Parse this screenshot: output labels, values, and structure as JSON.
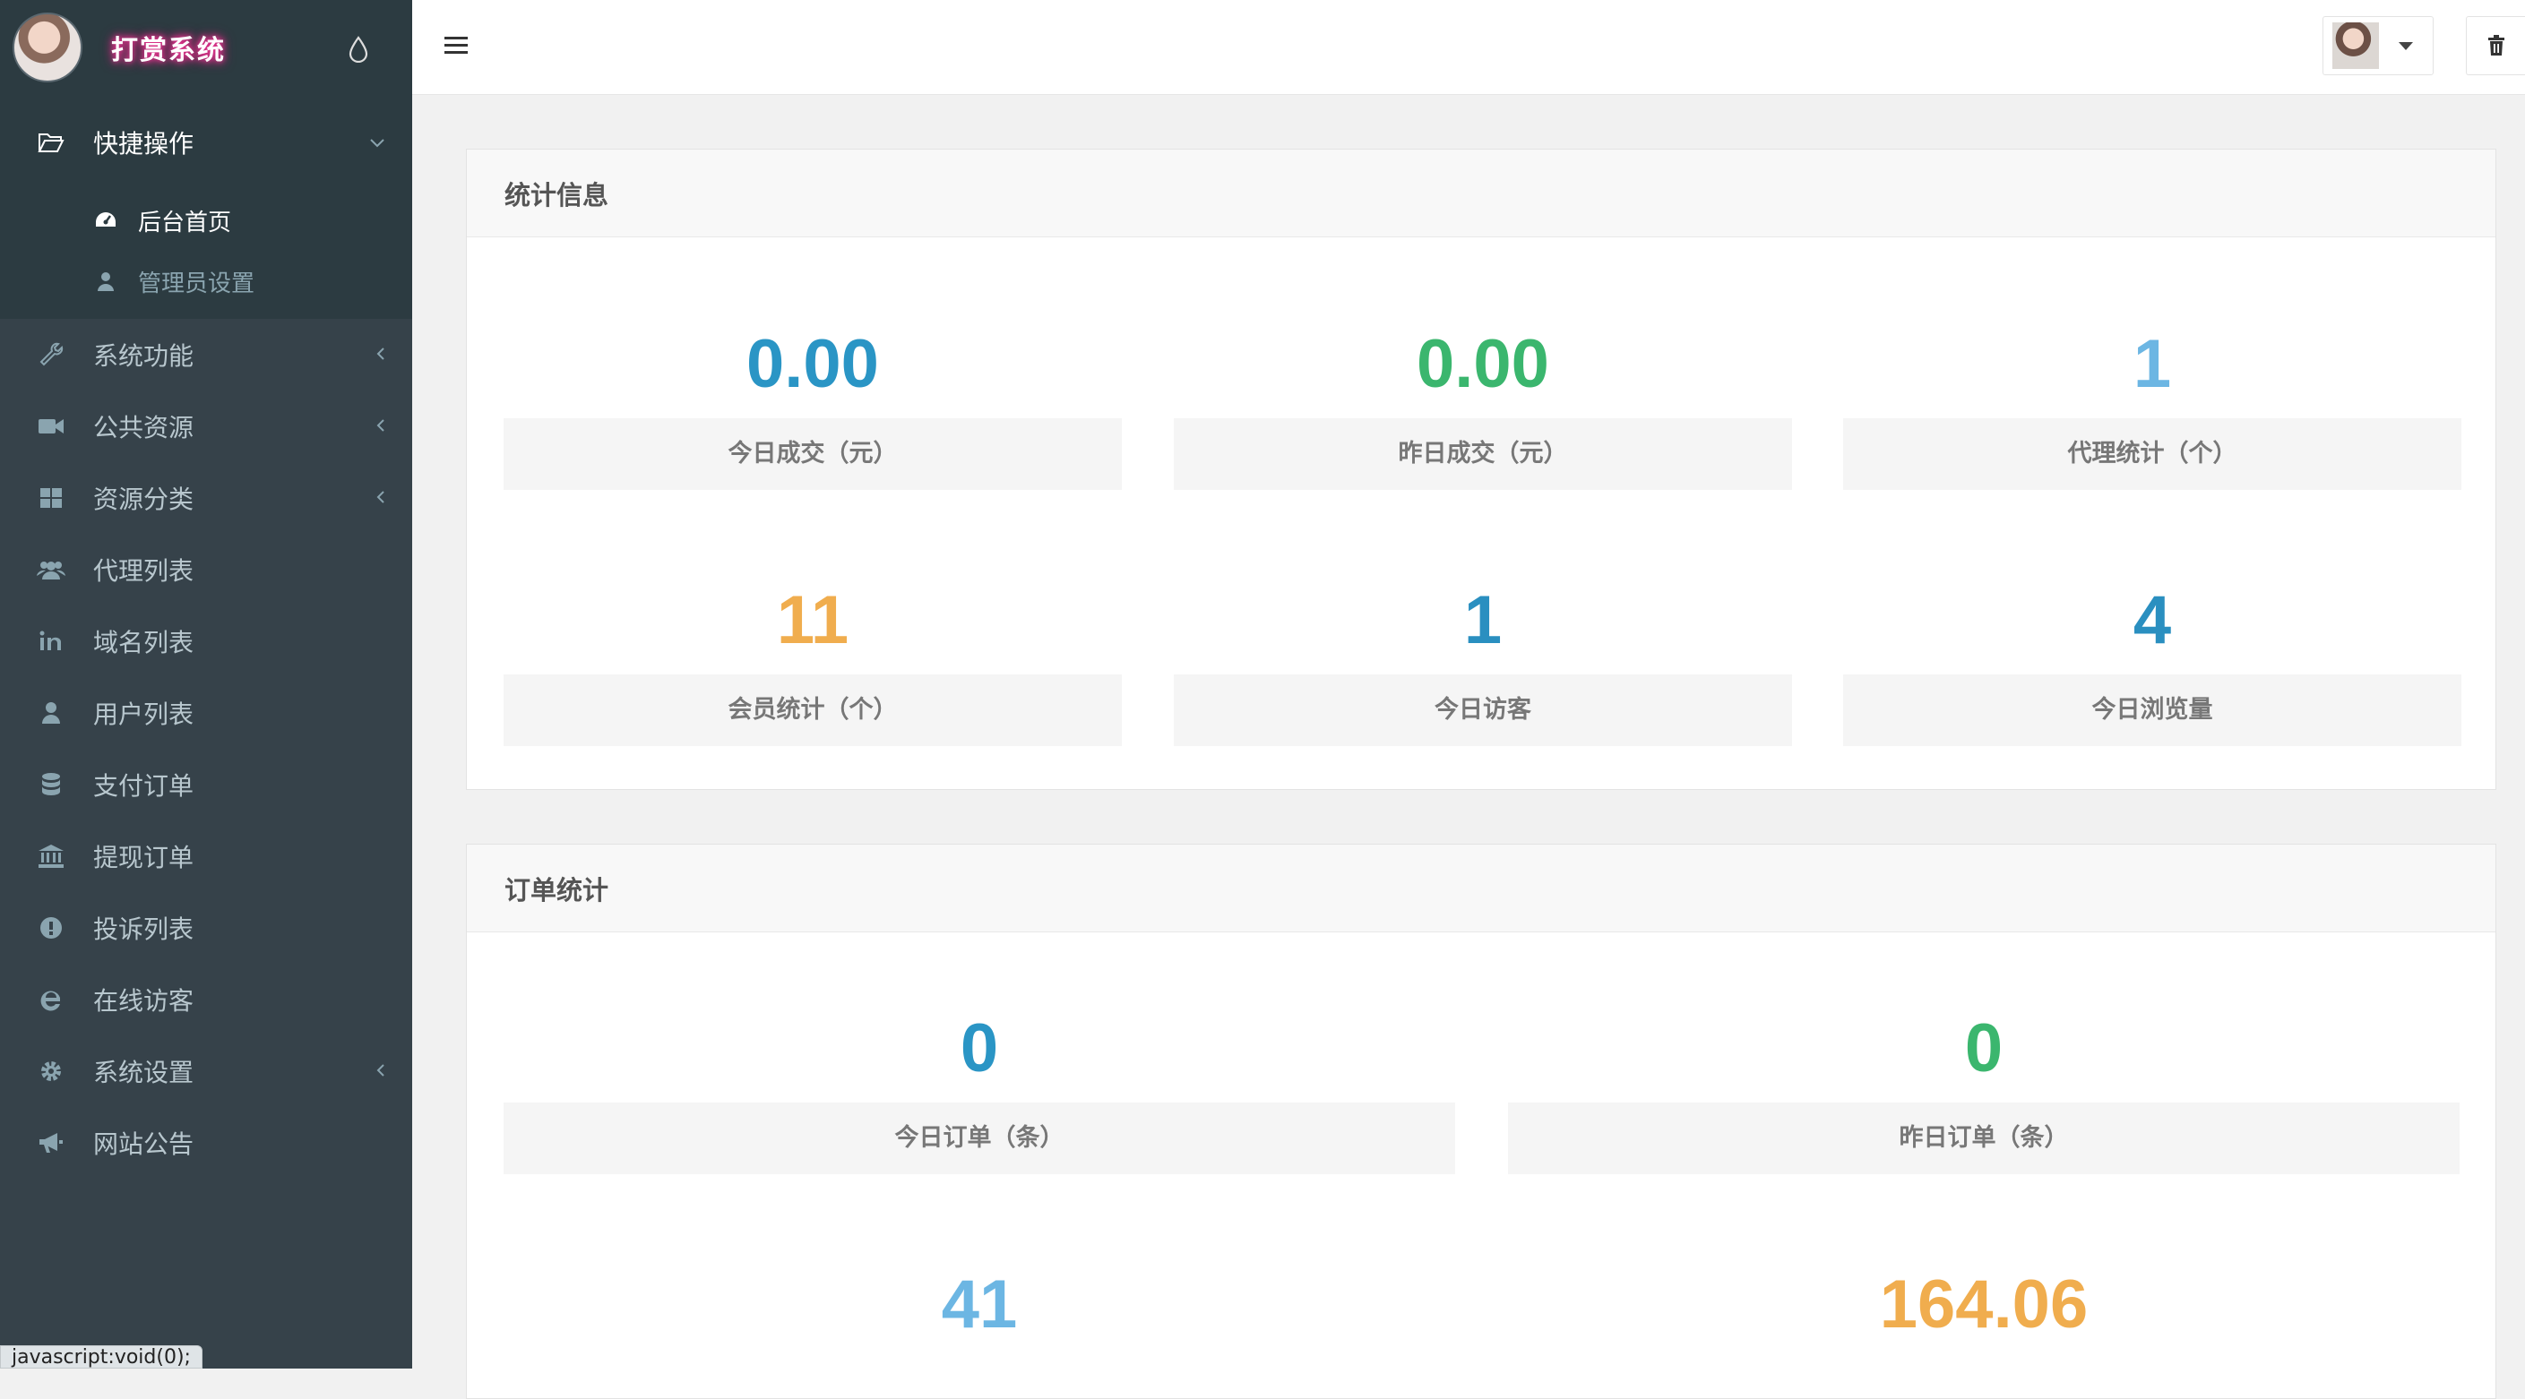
{
  "brand": {
    "title": "打赏系统"
  },
  "sidebar": {
    "group": {
      "label": "快捷操作",
      "items": [
        {
          "label": "后台首页",
          "icon": "dashboard-icon",
          "active": true
        },
        {
          "label": "管理员设置",
          "icon": "user-icon",
          "active": false
        }
      ]
    },
    "items": [
      {
        "label": "系统功能",
        "icon": "wrench-icon",
        "submenu": true
      },
      {
        "label": "公共资源",
        "icon": "video-camera-icon",
        "submenu": true
      },
      {
        "label": "资源分类",
        "icon": "grid-icon",
        "submenu": true
      },
      {
        "label": "代理列表",
        "icon": "users-icon",
        "submenu": false
      },
      {
        "label": "域名列表",
        "icon": "linkedin-icon",
        "submenu": false
      },
      {
        "label": "用户列表",
        "icon": "user-icon",
        "submenu": false
      },
      {
        "label": "支付订单",
        "icon": "database-icon",
        "submenu": false
      },
      {
        "label": "提现订单",
        "icon": "bank-icon",
        "submenu": false
      },
      {
        "label": "投诉列表",
        "icon": "exclamation-circle-icon",
        "submenu": false
      },
      {
        "label": "在线访客",
        "icon": "ie-icon",
        "submenu": false
      },
      {
        "label": "系统设置",
        "icon": "gear-icon",
        "submenu": true
      },
      {
        "label": "网站公告",
        "icon": "bullhorn-icon",
        "submenu": false
      }
    ]
  },
  "status_bar": {
    "text": "javascript:void(0);"
  },
  "stats_panel": {
    "title": "统计信息",
    "cells": [
      {
        "value": "0.00",
        "label": "今日成交（元）",
        "color": "#2a95c5"
      },
      {
        "value": "0.00",
        "label": "昨日成交（元）",
        "color": "#3bb66e"
      },
      {
        "value": "1",
        "label": "代理统计（个）",
        "color": "#6cb6e3"
      },
      {
        "value": "11",
        "label": "会员统计（个）",
        "color": "#f0ad4e"
      },
      {
        "value": "1",
        "label": "今日访客",
        "color": "#2a8fc0"
      },
      {
        "value": "4",
        "label": "今日浏览量",
        "color": "#2a8fc0"
      }
    ]
  },
  "orders_panel": {
    "title": "订单统计",
    "cells": [
      {
        "value": "0",
        "label": "今日订单（条）",
        "color": "#2a95c5"
      },
      {
        "value": "0",
        "label": "昨日订单（条）",
        "color": "#3bb66e"
      },
      {
        "value": "41",
        "color": "#6cb6e3"
      },
      {
        "value": "164.06",
        "color": "#f0ad4e"
      }
    ]
  }
}
